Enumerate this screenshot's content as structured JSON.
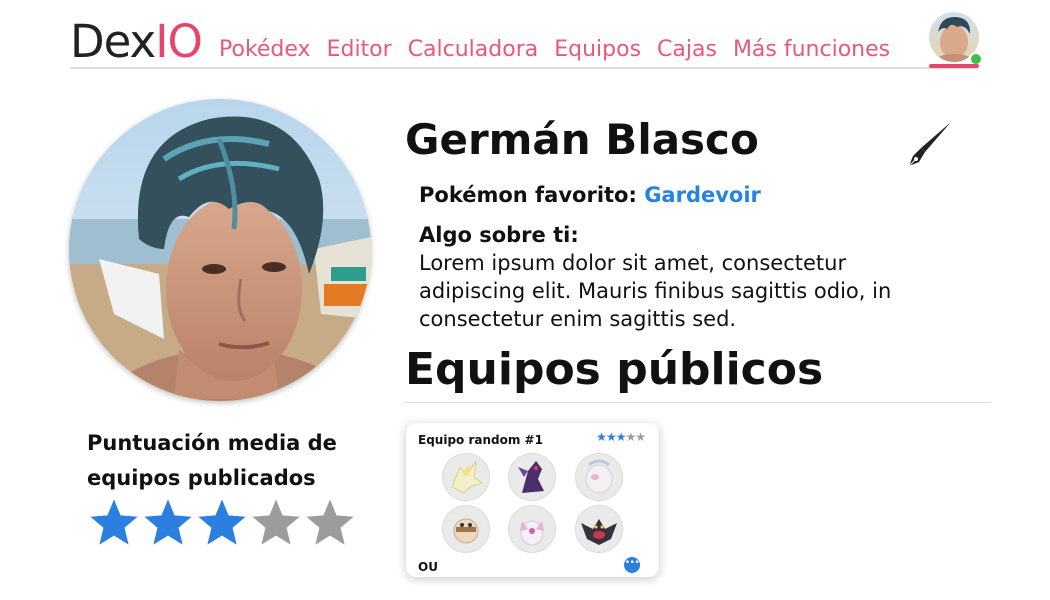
{
  "nav": {
    "logo_part1": "Dex",
    "logo_part2": "IO",
    "items": [
      "Pokédex",
      "Editor",
      "Calculadora",
      "Equipos",
      "Cajas",
      "Más funciones"
    ]
  },
  "profile": {
    "name": "Germán Blasco",
    "favorite_label": "Pokémon favorito:",
    "favorite_value": "Gardevoir",
    "about_title": "Algo sobre ti:",
    "about_text": "Lorem ipsum dolor sit amet, consectetur adipiscing elit. Mauris finibus sagittis odio, in consectetur enim sagittis sed."
  },
  "rating": {
    "label": "Puntuación media de equipos publicados",
    "value": 3,
    "max": 5
  },
  "teams_section": {
    "title": "Equipos públicos"
  },
  "teams": [
    {
      "name": "Equipo random #1",
      "stars": 3,
      "stars_max": 5,
      "tier": "OU",
      "pokemon_icons": [
        "electric-cat-icon",
        "purple-dragon-icon",
        "pink-pokemon-icon",
        "fighting-pokemon-icon",
        "fairy-pokemon-icon",
        "dark-pokemon-icon"
      ]
    }
  ],
  "colors": {
    "accent_pink": "#e8456b",
    "link_blue": "#2583e4",
    "star_blue": "#2a7fe0",
    "star_gray": "#9c9c9c",
    "online_green": "#3cc14a"
  }
}
